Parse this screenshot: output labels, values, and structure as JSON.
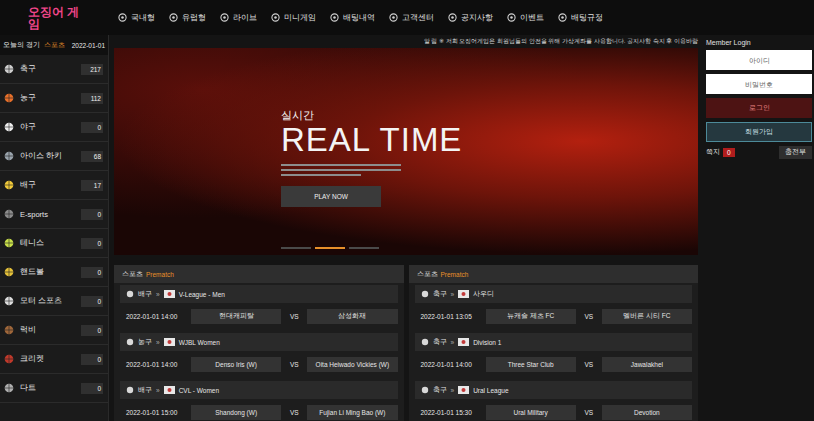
{
  "header": {
    "logo": "오징어 게임",
    "nav": [
      {
        "label": "국내형"
      },
      {
        "label": "유럽형"
      },
      {
        "label": "라이브"
      },
      {
        "label": "미니게임"
      },
      {
        "label": "배팅내역"
      },
      {
        "label": "고객센터"
      },
      {
        "label": "공지사항"
      },
      {
        "label": "이벤트"
      },
      {
        "label": "배팅규정"
      }
    ]
  },
  "sidebar": {
    "title": "오늘의 경기",
    "tag": "스포츠",
    "date": "2022-01-01",
    "items": [
      {
        "name": "축구",
        "count": "217",
        "color": "#d0d0d0"
      },
      {
        "name": "농구",
        "count": "112",
        "color": "#e8702a"
      },
      {
        "name": "야구",
        "count": "0",
        "color": "#eeeeee"
      },
      {
        "name": "아이스 하키",
        "count": "68",
        "color": "#9aa4ad"
      },
      {
        "name": "배구",
        "count": "17",
        "color": "#f0c93a"
      },
      {
        "name": "E-sports",
        "count": "0",
        "color": "#8c8c8c"
      },
      {
        "name": "테니스",
        "count": "0",
        "color": "#c9e04a"
      },
      {
        "name": "핸드볼",
        "count": "0",
        "color": "#e6c23a"
      },
      {
        "name": "모터 스포츠",
        "count": "0",
        "color": "#dddddd"
      },
      {
        "name": "럭비",
        "count": "0",
        "color": "#a0673a"
      },
      {
        "name": "크리켓",
        "count": "0",
        "color": "#c0392b"
      },
      {
        "name": "다트",
        "count": "0",
        "color": "#b0b0b0"
      }
    ]
  },
  "ticker": "알 림 ※ 저희 오징어게임은 회원님들의 안전을 위해 가상계좌를 사용합니다. 공지사항 숙지 후 이용바람",
  "banner": {
    "kicker": "실시간",
    "title": "REAL TIME",
    "button": "PLAY NOW",
    "slides": [
      {
        "selected": false
      },
      {
        "selected": true
      },
      {
        "selected": false
      }
    ]
  },
  "panels": [
    {
      "title": "스포츠",
      "tag": "Prematch",
      "separator": "»",
      "matches": [
        {
          "sport": "배구",
          "league": "V-League - Men",
          "time": "2022-01-01 14:00",
          "home": "현대캐피탈",
          "vs": "VS",
          "away": "삼성화재"
        },
        {
          "sport": "농구",
          "league": "WJBL Women",
          "time": "2022-01-01 14:00",
          "home": "Denso Iris (W)",
          "vs": "VS",
          "away": "Oita Heiwado Vickies (W)"
        },
        {
          "sport": "배구",
          "league": "CVL - Women",
          "time": "2022-01-01 15:00",
          "home": "Shandong (W)",
          "vs": "VS",
          "away": "Fujian Li Ming Bao (W)"
        }
      ]
    },
    {
      "title": "스포츠",
      "tag": "Prematch",
      "separator": "»",
      "matches": [
        {
          "sport": "축구",
          "league": "사우디",
          "time": "2022-01-01 13:05",
          "home": "뉴캐슬 제츠 FC",
          "vs": "VS",
          "away": "멜버른 시티 FC"
        },
        {
          "sport": "축구",
          "league": "Division 1",
          "time": "2022-01-01 14:00",
          "home": "Three Star Club",
          "vs": "VS",
          "away": "Jawalakhel"
        },
        {
          "sport": "축구",
          "league": "Ural League",
          "time": "2022-01-01 15:30",
          "home": "Ural Military",
          "vs": "VS",
          "away": "Devotion"
        }
      ]
    }
  ],
  "member": {
    "title": "Member Login",
    "id_placeholder": "아이디",
    "pw_placeholder": "비밀번호",
    "login": "로그인",
    "signup": "회원가입",
    "note_label": "쪽지",
    "note_count": "0",
    "charge": "충전부"
  }
}
